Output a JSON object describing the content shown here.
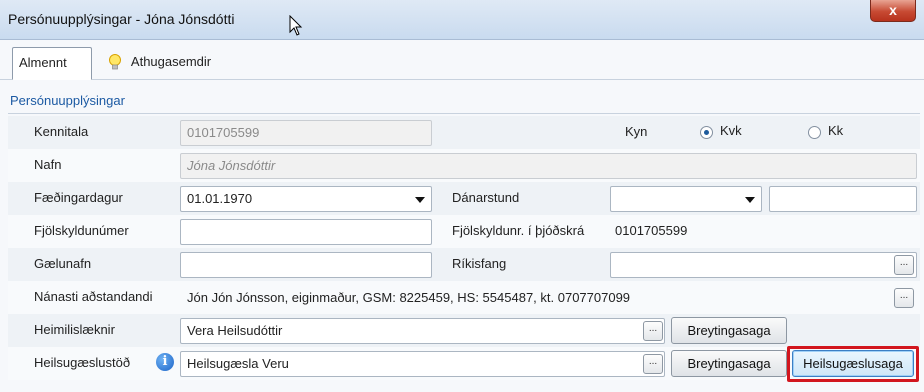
{
  "window": {
    "title": "Persónuupplýsingar - Jóna Jónsdótti",
    "close_label": "x"
  },
  "tabs": [
    {
      "label": "Almennt"
    },
    {
      "label": "Athugasemdir"
    }
  ],
  "group": {
    "title": "Persónuupplýsingar"
  },
  "fields": {
    "kennitala": {
      "label": "Kennitala",
      "value": "0101705599"
    },
    "kyn": {
      "label": "Kyn",
      "options": [
        "Kvk",
        "Kk"
      ],
      "selected": "Kvk"
    },
    "nafn": {
      "label": "Nafn",
      "value": "Jóna Jónsdóttir"
    },
    "faedingardagur": {
      "label": "Fæðingardagur",
      "value": "01.01.1970"
    },
    "danarstund": {
      "label": "Dánarstund",
      "value": "",
      "time_value": ""
    },
    "fjolskyldunumer": {
      "label": "Fjölskyldunúmer",
      "value": ""
    },
    "fjolskyldunr_thjodskra": {
      "label": "Fjölskyldunr. í þjóðskrá",
      "value": "0101705599"
    },
    "gaelunafn": {
      "label": "Gælunafn",
      "value": ""
    },
    "rikisfang": {
      "label": "Ríkisfang",
      "value": ""
    },
    "nanasti_adstandandi": {
      "label": "Nánasti aðstandandi",
      "value": "Jón Jón Jónsson, eiginmaður, GSM: 8225459, HS: 5545487, kt. 0707707099"
    },
    "heimilislaeknir": {
      "label": "Heimilislæknir",
      "value": "Vera Heilsudóttir"
    },
    "heilsugaeslustod": {
      "label": "Heilsugæslustöð",
      "value": "Heilsugæsla Veru"
    }
  },
  "buttons": {
    "ellipsis": "...",
    "breytingasaga": "Breytingasaga",
    "heilsugaeslusaga": "Heilsugæslusaga"
  },
  "colors": {
    "group_title": "#1c5aa3",
    "highlight_frame": "#d2161e"
  }
}
